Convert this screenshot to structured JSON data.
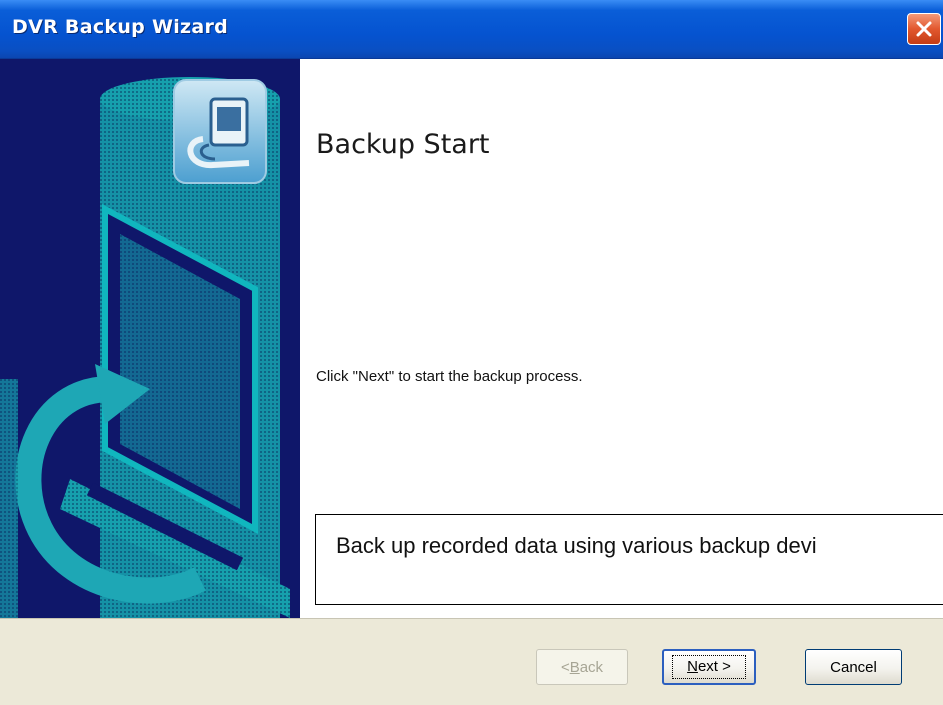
{
  "window": {
    "title": "DVR Backup Wizard"
  },
  "page": {
    "title": "Backup Start",
    "instruction": "Click \"Next\" to start the backup process.",
    "note": "Back up recorded data using various backup devi"
  },
  "buttons": {
    "back": {
      "mnemonic": "B",
      "rest": "ack",
      "prefix": "< "
    },
    "next": {
      "mnemonic": "N",
      "rest": "ext",
      "suffix": " >"
    },
    "cancel": "Cancel"
  },
  "colors": {
    "titlebar": "#0553d0",
    "side_panel": "#0f176a",
    "side_art": "#1f8a9a",
    "close": "#e2582f",
    "button_bar": "#ece9d8"
  },
  "icons": [
    "close-icon",
    "backup-device-icon",
    "wizard-banner-art"
  ]
}
